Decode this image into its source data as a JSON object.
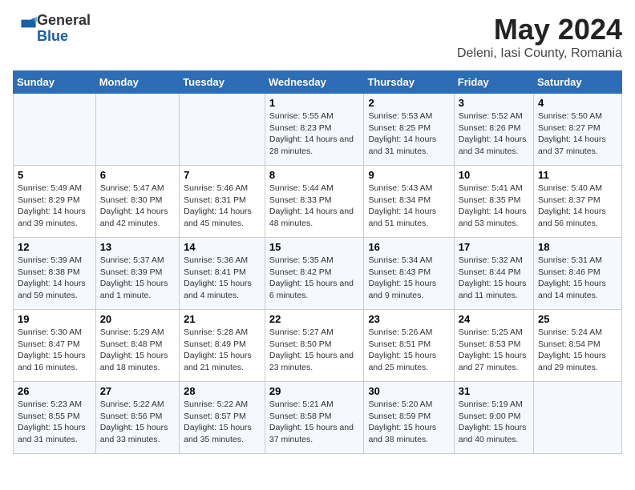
{
  "header": {
    "logo_line1": "General",
    "logo_line2": "Blue",
    "month_title": "May 2024",
    "location": "Deleni, Iasi County, Romania"
  },
  "days_of_week": [
    "Sunday",
    "Monday",
    "Tuesday",
    "Wednesday",
    "Thursday",
    "Friday",
    "Saturday"
  ],
  "weeks": [
    [
      {
        "day": "",
        "info": ""
      },
      {
        "day": "",
        "info": ""
      },
      {
        "day": "",
        "info": ""
      },
      {
        "day": "1",
        "info": "Sunrise: 5:55 AM\nSunset: 8:23 PM\nDaylight: 14 hours\nand 28 minutes."
      },
      {
        "day": "2",
        "info": "Sunrise: 5:53 AM\nSunset: 8:25 PM\nDaylight: 14 hours\nand 31 minutes."
      },
      {
        "day": "3",
        "info": "Sunrise: 5:52 AM\nSunset: 8:26 PM\nDaylight: 14 hours\nand 34 minutes."
      },
      {
        "day": "4",
        "info": "Sunrise: 5:50 AM\nSunset: 8:27 PM\nDaylight: 14 hours\nand 37 minutes."
      }
    ],
    [
      {
        "day": "5",
        "info": "Sunrise: 5:49 AM\nSunset: 8:29 PM\nDaylight: 14 hours\nand 39 minutes."
      },
      {
        "day": "6",
        "info": "Sunrise: 5:47 AM\nSunset: 8:30 PM\nDaylight: 14 hours\nand 42 minutes."
      },
      {
        "day": "7",
        "info": "Sunrise: 5:46 AM\nSunset: 8:31 PM\nDaylight: 14 hours\nand 45 minutes."
      },
      {
        "day": "8",
        "info": "Sunrise: 5:44 AM\nSunset: 8:33 PM\nDaylight: 14 hours\nand 48 minutes."
      },
      {
        "day": "9",
        "info": "Sunrise: 5:43 AM\nSunset: 8:34 PM\nDaylight: 14 hours\nand 51 minutes."
      },
      {
        "day": "10",
        "info": "Sunrise: 5:41 AM\nSunset: 8:35 PM\nDaylight: 14 hours\nand 53 minutes."
      },
      {
        "day": "11",
        "info": "Sunrise: 5:40 AM\nSunset: 8:37 PM\nDaylight: 14 hours\nand 56 minutes."
      }
    ],
    [
      {
        "day": "12",
        "info": "Sunrise: 5:39 AM\nSunset: 8:38 PM\nDaylight: 14 hours\nand 59 minutes."
      },
      {
        "day": "13",
        "info": "Sunrise: 5:37 AM\nSunset: 8:39 PM\nDaylight: 15 hours\nand 1 minute."
      },
      {
        "day": "14",
        "info": "Sunrise: 5:36 AM\nSunset: 8:41 PM\nDaylight: 15 hours\nand 4 minutes."
      },
      {
        "day": "15",
        "info": "Sunrise: 5:35 AM\nSunset: 8:42 PM\nDaylight: 15 hours\nand 6 minutes."
      },
      {
        "day": "16",
        "info": "Sunrise: 5:34 AM\nSunset: 8:43 PM\nDaylight: 15 hours\nand 9 minutes."
      },
      {
        "day": "17",
        "info": "Sunrise: 5:32 AM\nSunset: 8:44 PM\nDaylight: 15 hours\nand 11 minutes."
      },
      {
        "day": "18",
        "info": "Sunrise: 5:31 AM\nSunset: 8:46 PM\nDaylight: 15 hours\nand 14 minutes."
      }
    ],
    [
      {
        "day": "19",
        "info": "Sunrise: 5:30 AM\nSunset: 8:47 PM\nDaylight: 15 hours\nand 16 minutes."
      },
      {
        "day": "20",
        "info": "Sunrise: 5:29 AM\nSunset: 8:48 PM\nDaylight: 15 hours\nand 18 minutes."
      },
      {
        "day": "21",
        "info": "Sunrise: 5:28 AM\nSunset: 8:49 PM\nDaylight: 15 hours\nand 21 minutes."
      },
      {
        "day": "22",
        "info": "Sunrise: 5:27 AM\nSunset: 8:50 PM\nDaylight: 15 hours\nand 23 minutes."
      },
      {
        "day": "23",
        "info": "Sunrise: 5:26 AM\nSunset: 8:51 PM\nDaylight: 15 hours\nand 25 minutes."
      },
      {
        "day": "24",
        "info": "Sunrise: 5:25 AM\nSunset: 8:53 PM\nDaylight: 15 hours\nand 27 minutes."
      },
      {
        "day": "25",
        "info": "Sunrise: 5:24 AM\nSunset: 8:54 PM\nDaylight: 15 hours\nand 29 minutes."
      }
    ],
    [
      {
        "day": "26",
        "info": "Sunrise: 5:23 AM\nSunset: 8:55 PM\nDaylight: 15 hours\nand 31 minutes."
      },
      {
        "day": "27",
        "info": "Sunrise: 5:22 AM\nSunset: 8:56 PM\nDaylight: 15 hours\nand 33 minutes."
      },
      {
        "day": "28",
        "info": "Sunrise: 5:22 AM\nSunset: 8:57 PM\nDaylight: 15 hours\nand 35 minutes."
      },
      {
        "day": "29",
        "info": "Sunrise: 5:21 AM\nSunset: 8:58 PM\nDaylight: 15 hours\nand 37 minutes."
      },
      {
        "day": "30",
        "info": "Sunrise: 5:20 AM\nSunset: 8:59 PM\nDaylight: 15 hours\nand 38 minutes."
      },
      {
        "day": "31",
        "info": "Sunrise: 5:19 AM\nSunset: 9:00 PM\nDaylight: 15 hours\nand 40 minutes."
      },
      {
        "day": "",
        "info": ""
      }
    ]
  ]
}
